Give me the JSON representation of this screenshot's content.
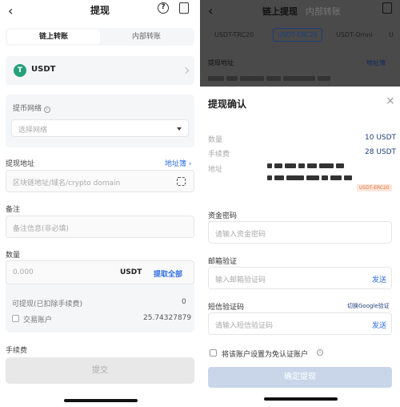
{
  "left": {
    "title": "提现",
    "tabs": [
      "链上转账",
      "内部转账"
    ],
    "coin": {
      "symbol": "T",
      "name": "USDT",
      "color": "#26a17b"
    },
    "network": {
      "label": "提币网络",
      "placeholder": "选择网络"
    },
    "address": {
      "label": "提现地址",
      "book": "地址簿",
      "placeholder": "区块链地址/域名/crypto domain"
    },
    "memo": {
      "label": "备注",
      "placeholder": "备注信息(非必填)"
    },
    "amount": {
      "label": "数量",
      "placeholder": "0.000",
      "unit": "USDT",
      "all": "提取全部"
    },
    "available": {
      "label": "可提现(已扣除手续费)",
      "value": "0"
    },
    "trade_account": {
      "label": "交易账户",
      "value": "25.74327879"
    },
    "fee": {
      "label": "手续费"
    },
    "submit": "提交"
  },
  "right": {
    "title_active": "链上提现",
    "title_inactive": "内部转账",
    "networks": [
      "USDT-TRC20",
      "USDT-ERC20",
      "USDT-Omni",
      "U"
    ],
    "addr_label": "提现地址",
    "addr_book": "地址簿",
    "sheet": {
      "title": "提现确认",
      "qty_label": "数量",
      "qty_value": "10 USDT",
      "fee_label": "手续费",
      "fee_value": "28 USDT",
      "addr_label": "地址",
      "network_tag": "USDT-ERC20",
      "fund_pwd_label": "资金密码",
      "fund_pwd_placeholder": "请输入资金密码",
      "email_label": "邮箱验证",
      "email_placeholder": "输入邮箱验证码",
      "send": "发送",
      "sms_label": "短信验证码",
      "switch_google": "切换Google验证",
      "sms_placeholder": "请输入短信验证码",
      "trust_label": "将该账户设置为免认证账户",
      "confirm": "确定提现"
    }
  },
  "colors": {
    "accent": "#2f6fdf",
    "tether": "#26a17b"
  }
}
